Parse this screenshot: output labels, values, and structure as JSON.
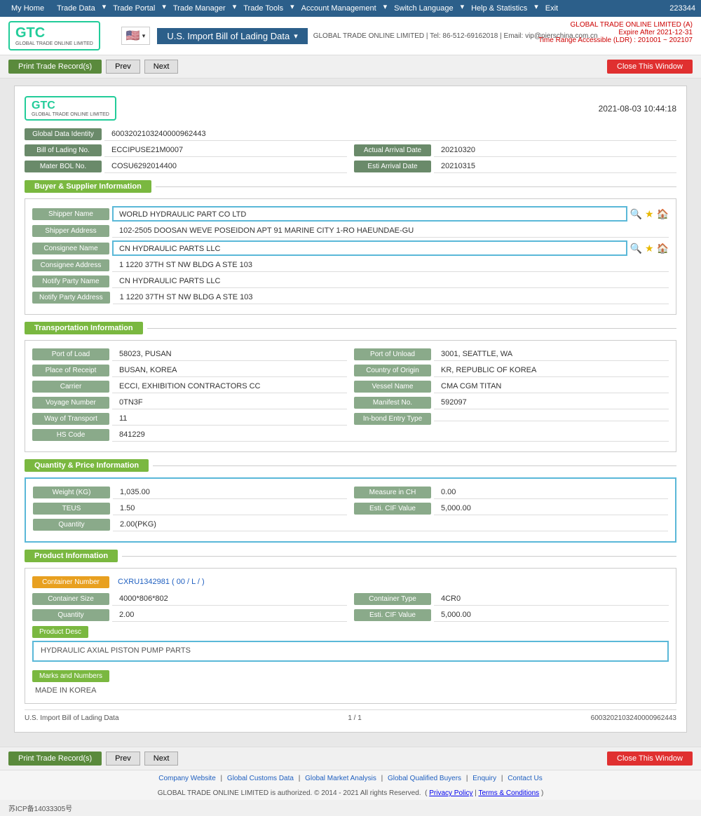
{
  "topnav": {
    "items": [
      "My Home",
      "Trade Data",
      "Trade Portal",
      "Trade Manager",
      "Trade Tools",
      "Account Management",
      "Switch Language",
      "Help & Statistics",
      "Exit"
    ],
    "user_id": "223344"
  },
  "header": {
    "logo_text": "GTC",
    "logo_sub": "GLOBAL TRADE ONLINE LIMITED",
    "title": "U.S. Import Bill of Lading Data",
    "subtitle": "GLOBAL TRADE ONLINE LIMITED | Tel: 86-512-69162018 | Email: vip@pierschina.com.cn",
    "account_name": "GLOBAL TRADE ONLINE LIMITED (A)",
    "expire": "Expire After 2021-12-31",
    "time_range": "Time Range Accessible (LDR) : 201001 ~ 202107"
  },
  "toolbar": {
    "print_label": "Print Trade Record(s)",
    "prev_label": "Prev",
    "next_label": "Next",
    "close_label": "Close This Window"
  },
  "record": {
    "date": "2021-08-03 10:44:18",
    "global_data_identity_label": "Global Data Identity",
    "global_data_identity_value": "600320210324000096244​3",
    "bol_no_label": "Bill of Lading No.",
    "bol_no_value": "ECCIPUSE21M0007",
    "actual_arrival_label": "Actual Arrival Date",
    "actual_arrival_value": "20210320",
    "mater_bol_label": "Mater BOL No.",
    "mater_bol_value": "COSU6292014400",
    "esti_arrival_label": "Esti Arrival Date",
    "esti_arrival_value": "20210315"
  },
  "buyer_supplier": {
    "section_title": "Buyer & Supplier Information",
    "shipper_name_label": "Shipper Name",
    "shipper_name_value": "WORLD HYDRAULIC PART CO LTD",
    "shipper_address_label": "Shipper Address",
    "shipper_address_value": "102-2505 DOOSAN WEVE POSEIDON APT 91 MARINE CITY 1-RO HAEUNDAE-GU",
    "consignee_name_label": "Consignee Name",
    "consignee_name_value": "CN HYDRAULIC PARTS LLC",
    "consignee_address_label": "Consignee Address",
    "consignee_address_value": "1 1220 37TH ST NW BLDG A STE 103",
    "notify_party_label": "Notify Party Name",
    "notify_party_value": "CN HYDRAULIC PARTS LLC",
    "notify_party_address_label": "Notify Party Address",
    "notify_party_address_value": "1 1220 37TH ST NW BLDG A STE 103"
  },
  "transportation": {
    "section_title": "Transportation Information",
    "port_of_load_label": "Port of Load",
    "port_of_load_value": "58023, PUSAN",
    "port_of_unload_label": "Port of Unload",
    "port_of_unload_value": "3001, SEATTLE, WA",
    "place_of_receipt_label": "Place of Receipt",
    "place_of_receipt_value": "BUSAN, KOREA",
    "country_of_origin_label": "Country of Origin",
    "country_of_origin_value": "KR, REPUBLIC OF KOREA",
    "carrier_label": "Carrier",
    "carrier_value": "ECCI, EXHIBITION CONTRACTORS CC",
    "vessel_name_label": "Vessel Name",
    "vessel_name_value": "CMA CGM TITAN",
    "voyage_number_label": "Voyage Number",
    "voyage_number_value": "0TN3F",
    "manifest_no_label": "Manifest No.",
    "manifest_no_value": "592097",
    "way_of_transport_label": "Way of Transport",
    "way_of_transport_value": "11",
    "in_bond_label": "In-bond Entry Type",
    "in_bond_value": "",
    "hs_code_label": "HS Code",
    "hs_code_value": "841229"
  },
  "quantity": {
    "section_title": "Quantity & Price Information",
    "weight_label": "Weight (KG)",
    "weight_value": "1,035.00",
    "measure_label": "Measure in CH",
    "measure_value": "0.00",
    "teus_label": "TEUS",
    "teus_value": "1.50",
    "esti_cif_label": "Esti. CIF Value",
    "esti_cif_value": "5,000.00",
    "quantity_label": "Quantity",
    "quantity_value": "2.00(PKG)"
  },
  "product": {
    "section_title": "Product Information",
    "container_number_label": "Container Number",
    "container_number_value": "CXRU1342981 ( 00 / L / )",
    "container_size_label": "Container Size",
    "container_size_value": "4000*806*802",
    "container_type_label": "Container Type",
    "container_type_value": "4CR0",
    "quantity_label": "Quantity",
    "quantity_value": "2.00",
    "esti_cif_label": "Esti. CIF Value",
    "esti_cif_value": "5,000.00",
    "prod_desc_label": "Product Desc",
    "prod_desc_value": "HYDRAULIC AXIAL PISTON PUMP PARTS",
    "marks_label": "Marks and Numbers",
    "marks_value": "MADE IN KOREA"
  },
  "card_footer": {
    "doc_type": "U.S. Import Bill of Lading Data",
    "page": "1 / 1",
    "id": "600320210324000096244​3"
  },
  "bottom_toolbar": {
    "print_label": "Print Trade Record(s)",
    "prev_label": "Prev",
    "next_label": "Next",
    "close_label": "Close This Window"
  },
  "footer": {
    "links": [
      "Company Website",
      "Global Customs Data",
      "Global Market Analysis",
      "Global Qualified Buyers",
      "Enquiry",
      "Contact Us"
    ],
    "copyright": "GLOBAL TRADE ONLINE LIMITED is authorized. © 2014 - 2021 All rights Reserved.",
    "privacy": "Privacy Policy",
    "terms": "Terms & Conditions",
    "icp": "苏ICP备14033305号"
  }
}
